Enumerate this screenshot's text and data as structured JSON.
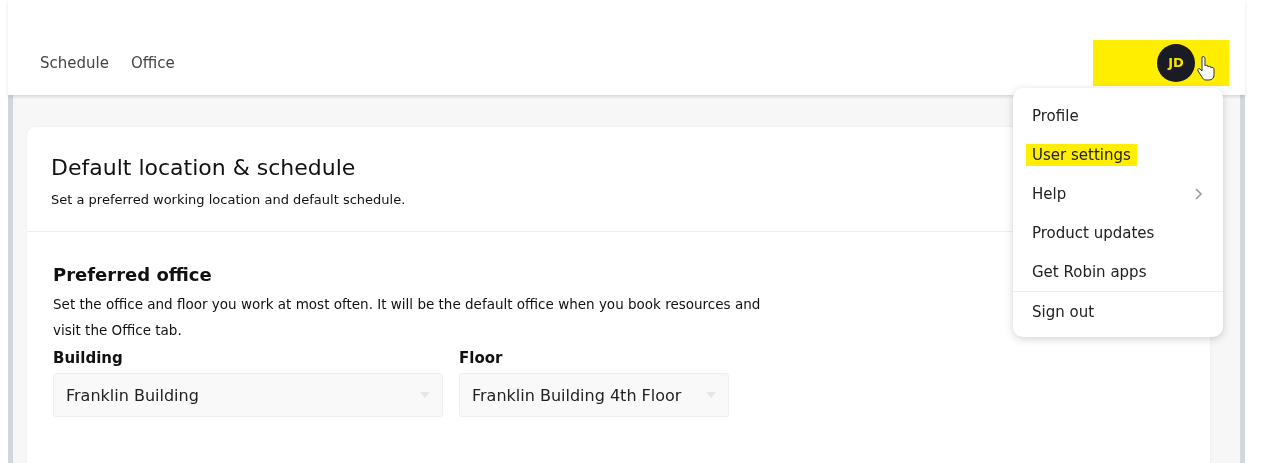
{
  "nav": {
    "tabs": [
      {
        "label": "Schedule"
      },
      {
        "label": "Office"
      }
    ]
  },
  "avatar": {
    "initials": "JD",
    "highlighted": true
  },
  "user_menu": {
    "items": [
      {
        "label": "Profile",
        "kind": "link",
        "highlighted": false,
        "separated": false
      },
      {
        "label": "User settings",
        "kind": "link",
        "highlighted": true,
        "separated": false
      },
      {
        "label": "Help",
        "kind": "submenu",
        "highlighted": false,
        "separated": false
      },
      {
        "label": "Product updates",
        "kind": "link",
        "highlighted": false,
        "separated": false
      },
      {
        "label": "Get Robin apps",
        "kind": "link",
        "highlighted": false,
        "separated": false
      },
      {
        "label": "Sign out",
        "kind": "link",
        "highlighted": false,
        "separated": true
      }
    ]
  },
  "card": {
    "title": "Default location & schedule",
    "subtitle": "Set a preferred working location and default schedule.",
    "section": {
      "title": "Preferred office",
      "description": "Set the office and floor you work at most often. It will be the default office when you book resources and visit the Office tab.",
      "fields": [
        {
          "label": "Building",
          "value": "Franklin Building"
        },
        {
          "label": "Floor",
          "value": "Franklin Building 4th Floor"
        }
      ]
    }
  }
}
